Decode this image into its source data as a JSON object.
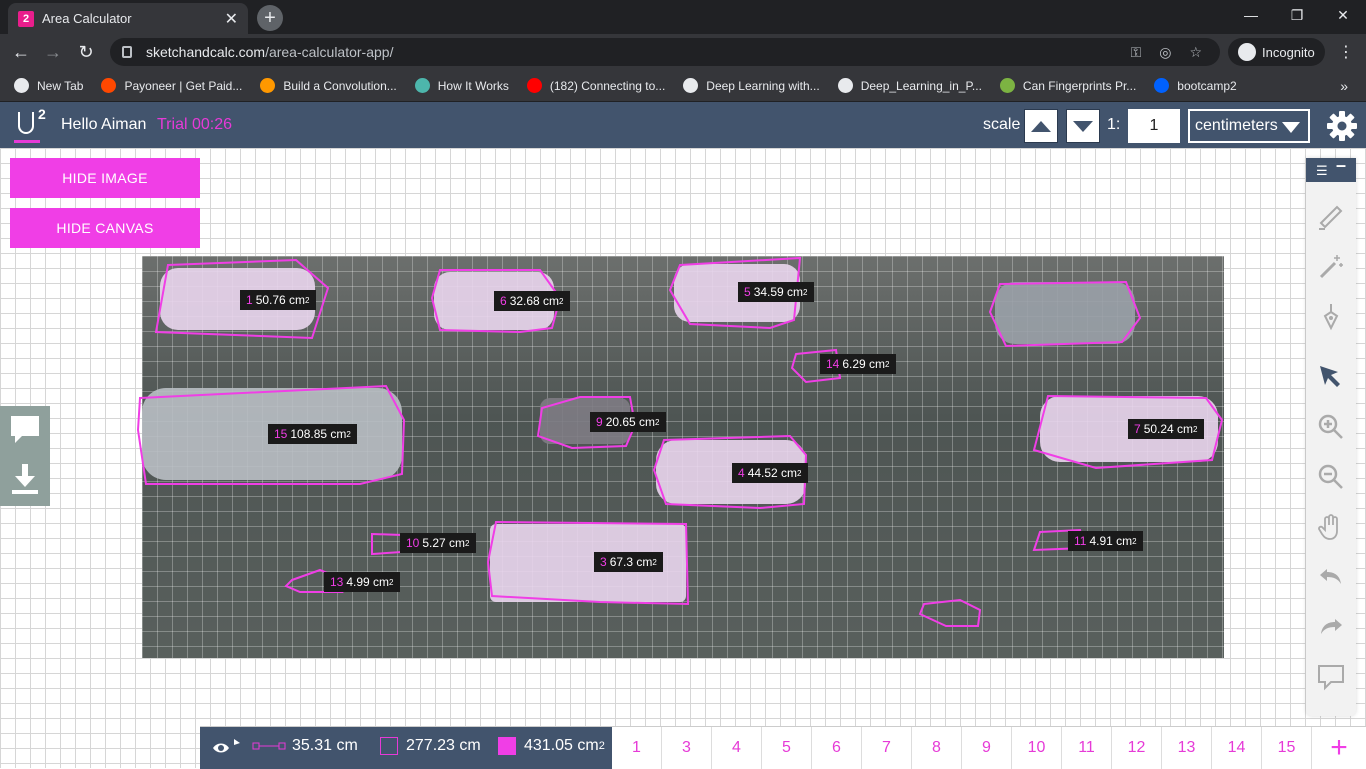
{
  "browser": {
    "tab_badge": "2",
    "tab_title": "Area Calculator",
    "url_host": "sketchandcalc.com",
    "url_path": "/area-calculator-app/",
    "incognito_label": "Incognito",
    "bookmarks": [
      {
        "label": "New Tab",
        "color": "#e8eaed"
      },
      {
        "label": "Payoneer | Get Paid...",
        "color": "#ff4800"
      },
      {
        "label": "Build a Convolution...",
        "color": "#ff9800"
      },
      {
        "label": "How It Works",
        "color": "#4db6ac"
      },
      {
        "label": "(182) Connecting to...",
        "color": "#ff0000"
      },
      {
        "label": "Deep Learning with...",
        "color": "#e8eaed"
      },
      {
        "label": "Deep_Learning_in_P...",
        "color": "#e8eaed"
      },
      {
        "label": "Can Fingerprints Pr...",
        "color": "#7cb342"
      },
      {
        "label": "bootcamp2",
        "color": "#0061fe"
      }
    ]
  },
  "header": {
    "greeting": "Hello Aiman",
    "trial": "Trial 00:26",
    "scale_label": "scale",
    "ratio_prefix": "1:",
    "ratio_value": "1",
    "unit": "centimeters"
  },
  "buttons": {
    "hide_image": "HIDE IMAGE",
    "hide_canvas": "HIDE CANVAS"
  },
  "shapes": [
    {
      "num": "1",
      "area": "50.76 cm",
      "unit_sup": "2"
    },
    {
      "num": "6",
      "area": "32.68 cm",
      "unit_sup": "2"
    },
    {
      "num": "5",
      "area": "34.59 cm",
      "unit_sup": "2"
    },
    {
      "num": "14",
      "area": "6.29 cm",
      "unit_sup": "2"
    },
    {
      "num": "15",
      "area": "108.85 cm",
      "unit_sup": "2"
    },
    {
      "num": "9",
      "area": "20.65 cm",
      "unit_sup": "2"
    },
    {
      "num": "7",
      "area": "50.24 cm",
      "unit_sup": "2"
    },
    {
      "num": "4",
      "area": "44.52 cm",
      "unit_sup": "2"
    },
    {
      "num": "10",
      "area": "5.27 cm",
      "unit_sup": "2"
    },
    {
      "num": "3",
      "area": "67.3 cm",
      "unit_sup": "2"
    },
    {
      "num": "11",
      "area": "4.91 cm",
      "unit_sup": "2"
    },
    {
      "num": "13",
      "area": "4.99 cm",
      "unit_sup": "2"
    }
  ],
  "stats": {
    "length": "35.31 cm",
    "perimeter": "277.23 cm",
    "area": "431.05 cm",
    "area_sup": "2"
  },
  "pages": [
    "1",
    "3",
    "4",
    "5",
    "6",
    "7",
    "8",
    "9",
    "10",
    "11",
    "12",
    "13",
    "14",
    "15"
  ],
  "colors": {
    "accent": "#f03ee6",
    "header": "#42546d"
  }
}
